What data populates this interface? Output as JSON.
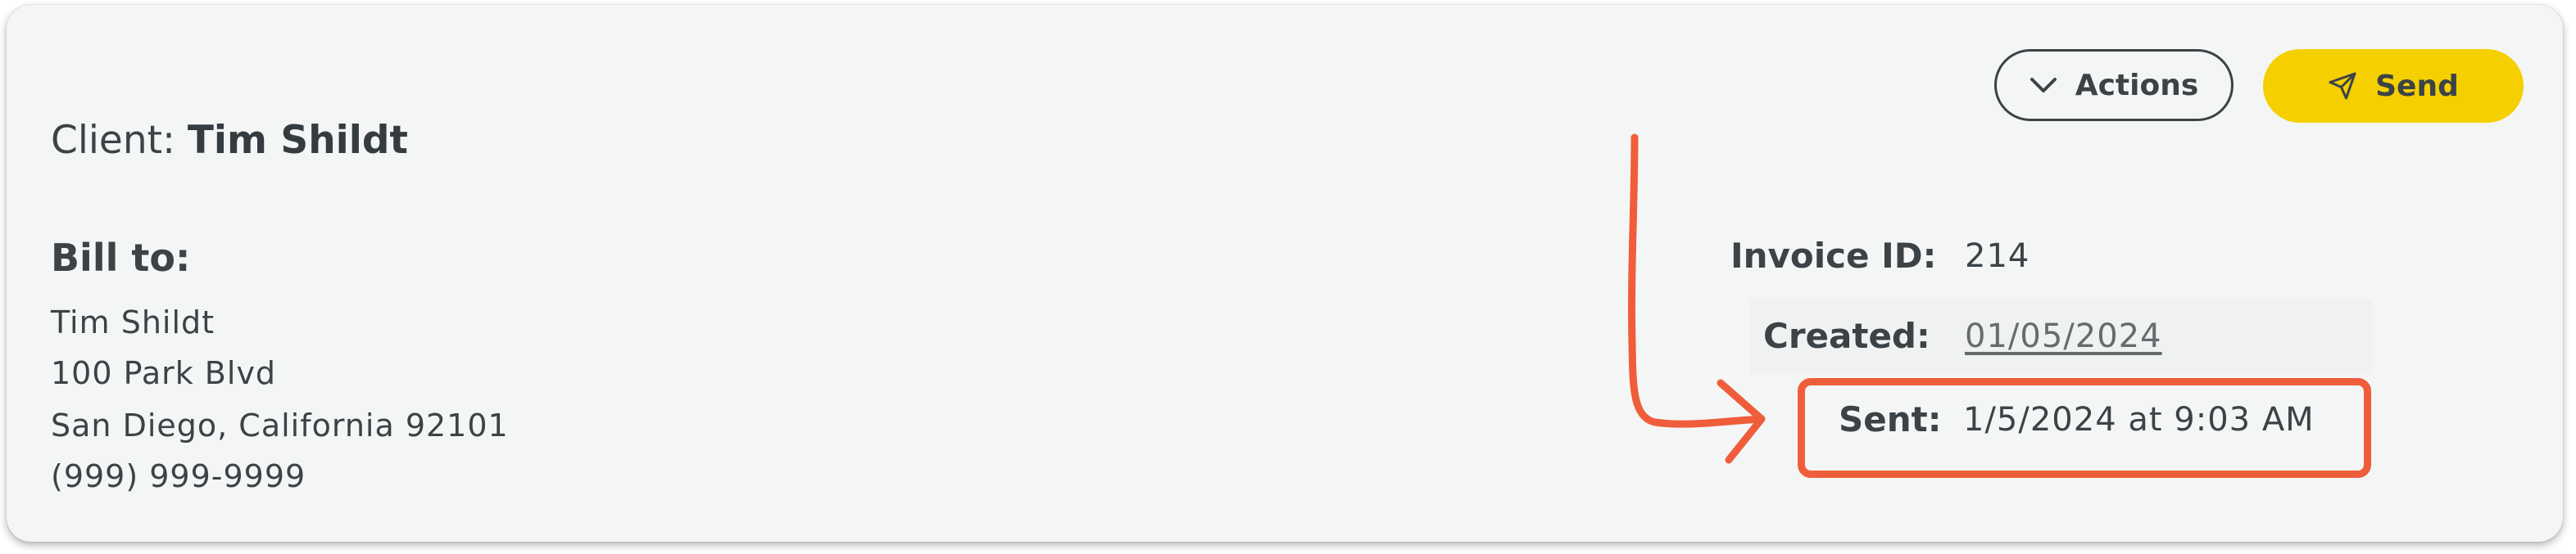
{
  "client": {
    "label": "Client:",
    "name": "Tim Shildt"
  },
  "actions": {
    "actions_label": "Actions",
    "send_label": "Send"
  },
  "bill_to": {
    "title": "Bill to:",
    "lines": [
      "Tim Shildt",
      "100 Park Blvd",
      "San Diego, California 92101",
      "(999) 999-9999"
    ]
  },
  "invoice": {
    "id_label": "Invoice ID:",
    "id_value": "214",
    "created_label": "Created:",
    "created_value": "01/05/2024",
    "sent_label": "Sent:",
    "sent_value": "1/5/2024 at 9:03 AM"
  },
  "colors": {
    "accent_send": "#f5cf00",
    "annotation": "#f05d3b",
    "text": "#3b4347"
  },
  "icons": {
    "actions_icon": "chevron-down-icon",
    "send_icon": "paper-plane-icon"
  }
}
